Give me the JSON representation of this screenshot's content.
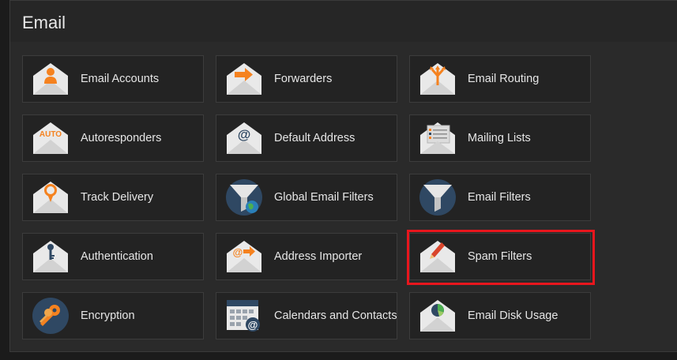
{
  "section": {
    "title": "Email"
  },
  "colors": {
    "accent_orange": "#f5821f",
    "envelope": "#e9e9e9",
    "envelope_shadow": "#c9c9c9",
    "navy": "#2f4863",
    "highlight_border": "#e8161d"
  },
  "tiles": [
    {
      "id": "email-accounts",
      "label": "Email Accounts",
      "icon": "envelope-user-icon"
    },
    {
      "id": "forwarders",
      "label": "Forwarders",
      "icon": "envelope-forward-arrow-icon"
    },
    {
      "id": "email-routing",
      "label": "Email Routing",
      "icon": "envelope-routing-icon"
    },
    {
      "id": "autoresponders",
      "label": "Autoresponders",
      "icon": "envelope-auto-icon"
    },
    {
      "id": "default-address",
      "label": "Default Address",
      "icon": "envelope-at-icon"
    },
    {
      "id": "mailing-lists",
      "label": "Mailing Lists",
      "icon": "envelope-list-icon"
    },
    {
      "id": "track-delivery",
      "label": "Track Delivery",
      "icon": "envelope-location-pin-icon"
    },
    {
      "id": "global-email-filters",
      "label": "Global Email Filters",
      "icon": "funnel-globe-icon"
    },
    {
      "id": "email-filters",
      "label": "Email Filters",
      "icon": "funnel-icon"
    },
    {
      "id": "authentication",
      "label": "Authentication",
      "icon": "envelope-key-icon"
    },
    {
      "id": "address-importer",
      "label": "Address Importer",
      "icon": "envelope-at-import-icon"
    },
    {
      "id": "spam-filters",
      "label": "Spam Filters",
      "icon": "envelope-pencil-icon",
      "highlighted": true
    },
    {
      "id": "encryption",
      "label": "Encryption",
      "icon": "keys-icon"
    },
    {
      "id": "calendars-and-contacts",
      "label": "Calendars and Contacts",
      "icon": "calendar-at-icon"
    },
    {
      "id": "email-disk-usage",
      "label": "Email Disk Usage",
      "icon": "envelope-pie-chart-icon"
    }
  ]
}
